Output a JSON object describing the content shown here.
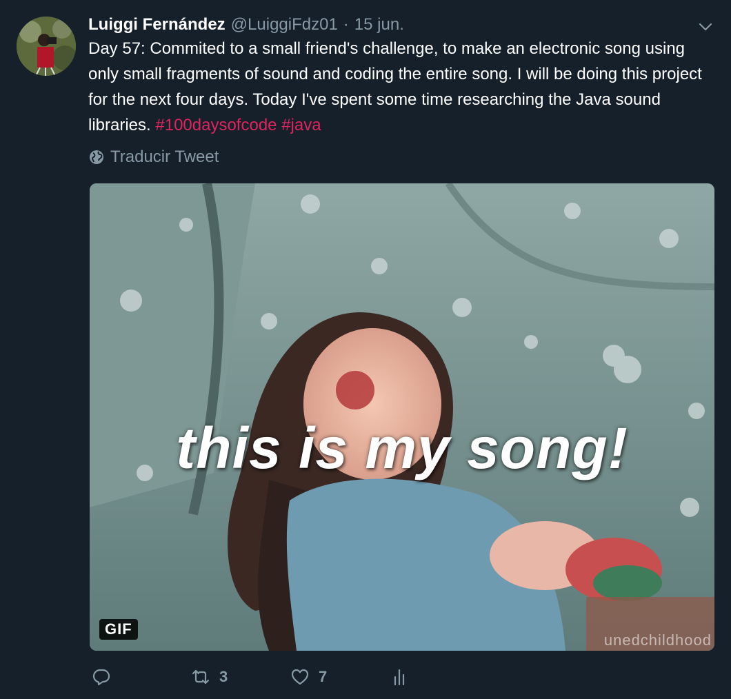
{
  "author": {
    "display_name": "Luiggi Fernández",
    "handle": "@LuiggiFdz01",
    "separator": "·",
    "date": "15 jun."
  },
  "tweet": {
    "text_before_hashtags": "Day 57: Commited to a small friend's challenge, to make an electronic song using only small fragments of sound and coding the entire song. I will be doing this project for the next four days. Today I've spent some time researching the Java sound libraries.",
    "hashtags": [
      "#100daysofcode",
      "#java"
    ]
  },
  "translate": {
    "label": "Traducir Tweet",
    "icon": "globe-icon"
  },
  "media": {
    "caption": "this is my song!",
    "watermark": "unedchildhood",
    "badge": "GIF"
  },
  "actions": {
    "reply": {
      "icon": "reply-icon",
      "count": ""
    },
    "retweet": {
      "icon": "retweet-icon",
      "count": "3"
    },
    "like": {
      "icon": "heart-icon",
      "count": "7"
    },
    "stats": {
      "icon": "analytics-icon"
    }
  },
  "colors": {
    "background": "#15202b",
    "text": "#ffffff",
    "muted": "#8899a6",
    "hashtag": "#e0245e"
  }
}
